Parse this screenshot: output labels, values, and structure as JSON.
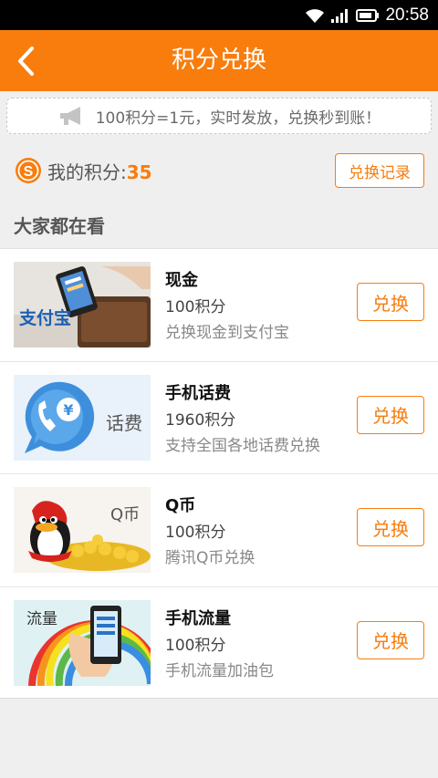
{
  "status_bar": {
    "time": "20:58",
    "icons": [
      "wifi-icon",
      "signal-icon",
      "battery-icon"
    ]
  },
  "header": {
    "title": "积分兑换",
    "back_icon": "chevron-left-icon"
  },
  "notice": {
    "text": "100积分=1元，实时发放，兑换秒到账！",
    "icon": "megaphone-icon"
  },
  "points": {
    "label": "我的积分:",
    "value": "35",
    "record_button": "兑换记录"
  },
  "section": {
    "title": "大家都在看"
  },
  "items": [
    {
      "name": "现金",
      "points": "100积分",
      "desc": "兑换现金到支付宝",
      "button": "兑换",
      "thumb_text": "支付宝"
    },
    {
      "name": "手机话费",
      "points": "1960积分",
      "desc": "支持全国各地话费兑换",
      "button": "兑换",
      "thumb_text": "话费"
    },
    {
      "name": "Q币",
      "points": "100积分",
      "desc": "腾讯Q币兑换",
      "button": "兑换",
      "thumb_text": "Q币"
    },
    {
      "name": "手机流量",
      "points": "100积分",
      "desc": "手机流量加油包",
      "button": "兑换",
      "thumb_text": "流量"
    }
  ],
  "colors": {
    "accent": "#f87d0d",
    "background": "#efefef"
  }
}
